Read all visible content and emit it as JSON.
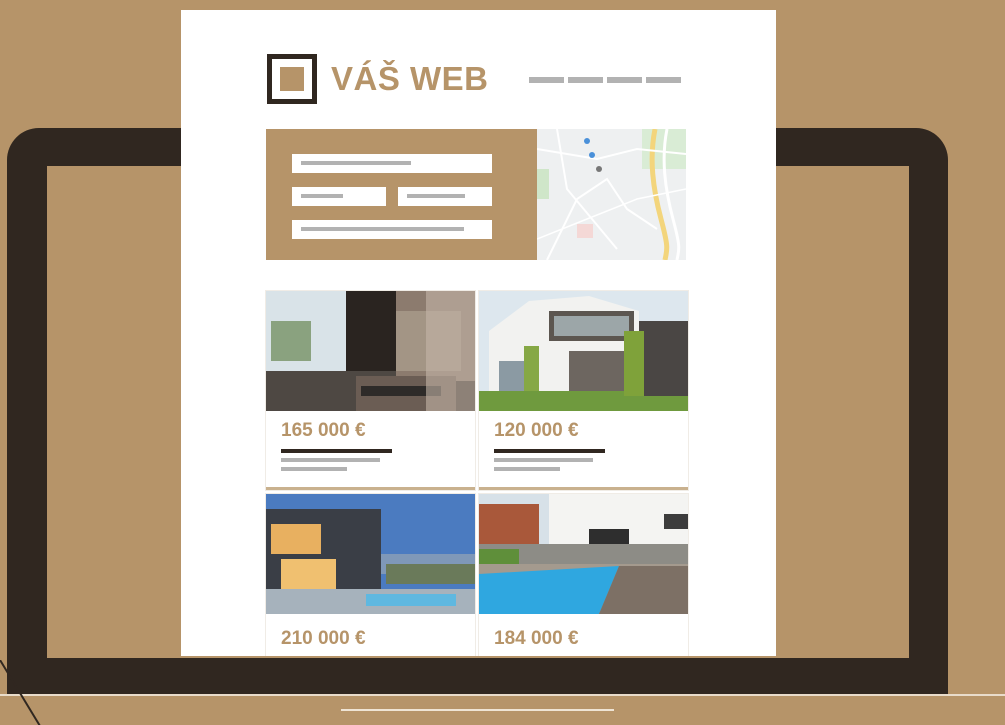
{
  "site": {
    "logo_text": "VÁŠ WEB",
    "nav_items": [
      "",
      "",
      "",
      ""
    ]
  },
  "listings": [
    {
      "price": "165 000 €"
    },
    {
      "price": "120 000 €"
    },
    {
      "price": "210 000 €"
    },
    {
      "price": "184 000 €"
    }
  ],
  "colors": {
    "background": "#b69469",
    "laptop": "#302720",
    "accent": "#b69469",
    "placeholder": "#b2b2b2"
  }
}
